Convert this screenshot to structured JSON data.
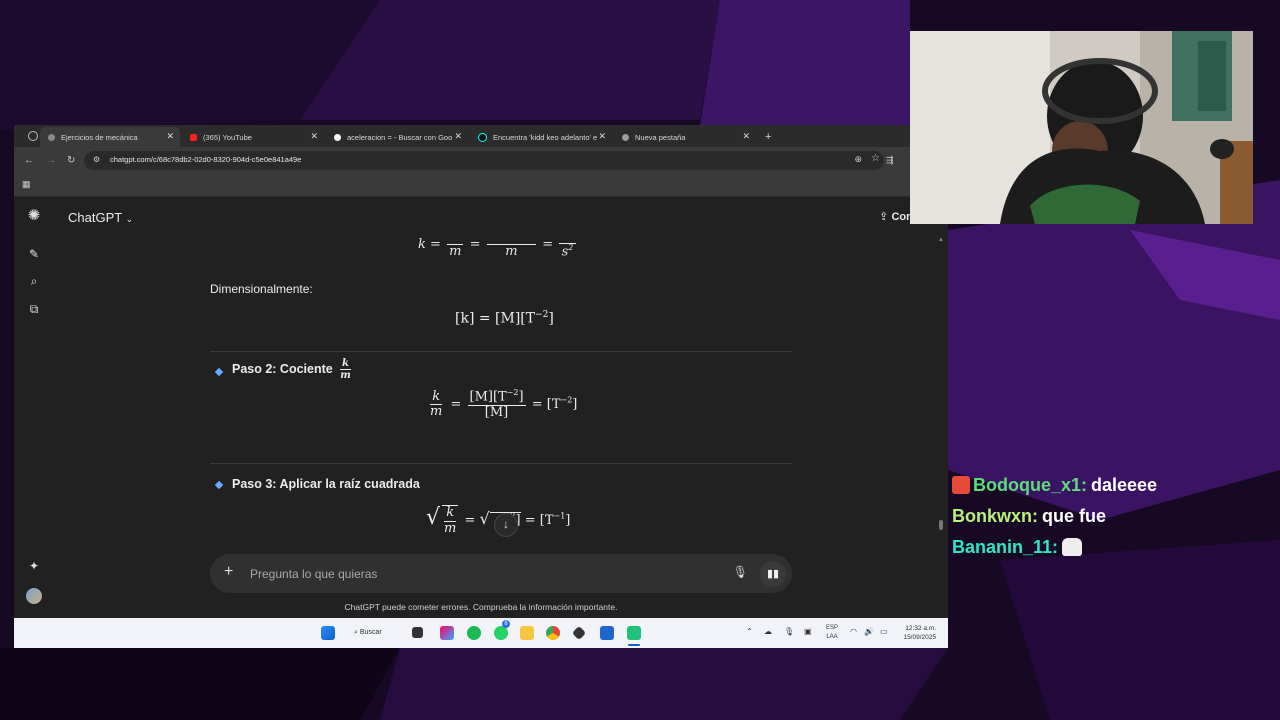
{
  "browser": {
    "tabs": [
      {
        "title": "Ejercicios de mecánica",
        "favicon_color": "#7a7a7a",
        "active": true
      },
      {
        "title": "(365) YouTube",
        "favicon_color": "#ff0000",
        "active": false
      },
      {
        "title": "aceleracion = - Buscar con Goo",
        "favicon_color": "#ffffff",
        "active": false
      },
      {
        "title": "Encuentra 'kidd keo adelanto' e",
        "favicon_color": "#000000",
        "active": false
      },
      {
        "title": "Nueva pestaña",
        "favicon_color": "#9a9a9a",
        "active": false
      }
    ],
    "new_tab_symbol": "+",
    "url": "chatgpt.com/c/68c78db2-02d0-8320-904d-c5e0e841a49e"
  },
  "chatgpt": {
    "brand": "ChatGPT",
    "share_label": "Compartir",
    "composer_placeholder": "Pregunta lo que quieras",
    "disclaimer": "ChatGPT puede cometer errores. Comprueba la información importante."
  },
  "content": {
    "dimension_label": "Dimensionalmente:",
    "eq_dim": "[k] = [M][T",
    "eq_dim_exp": "−2",
    "step2_title": "Paso 2: Cociente",
    "step2_frac_num": "k",
    "step2_frac_den": "m",
    "eq2_num": "[M][T",
    "eq2_num_exp": "−2",
    "eq2_den": "[M]",
    "eq2_rhs": "= [T",
    "eq2_rhs_exp": "−2",
    "step3_title": "Paso 3: Aplicar la raíz cuadrada",
    "eq3_rhs": "= [T",
    "eq3_rhs_exp": "−1"
  },
  "taskbar": {
    "search_label": "Buscar",
    "lang_line1": "ESP",
    "lang_line2": "LAA",
    "time": "12:32 a.m.",
    "date": "15/09/2025",
    "whatsapp_badge": "8"
  },
  "chat_overlay": [
    {
      "user": "Bodoque_x1:",
      "message": "daleeee",
      "color": "#5ddc7a"
    },
    {
      "user": "Bonkwxn:",
      "message": "que fue",
      "color": "#b7f27a"
    },
    {
      "user": "Bananin_11:",
      "message": "",
      "color": "#2ee6c8"
    }
  ]
}
